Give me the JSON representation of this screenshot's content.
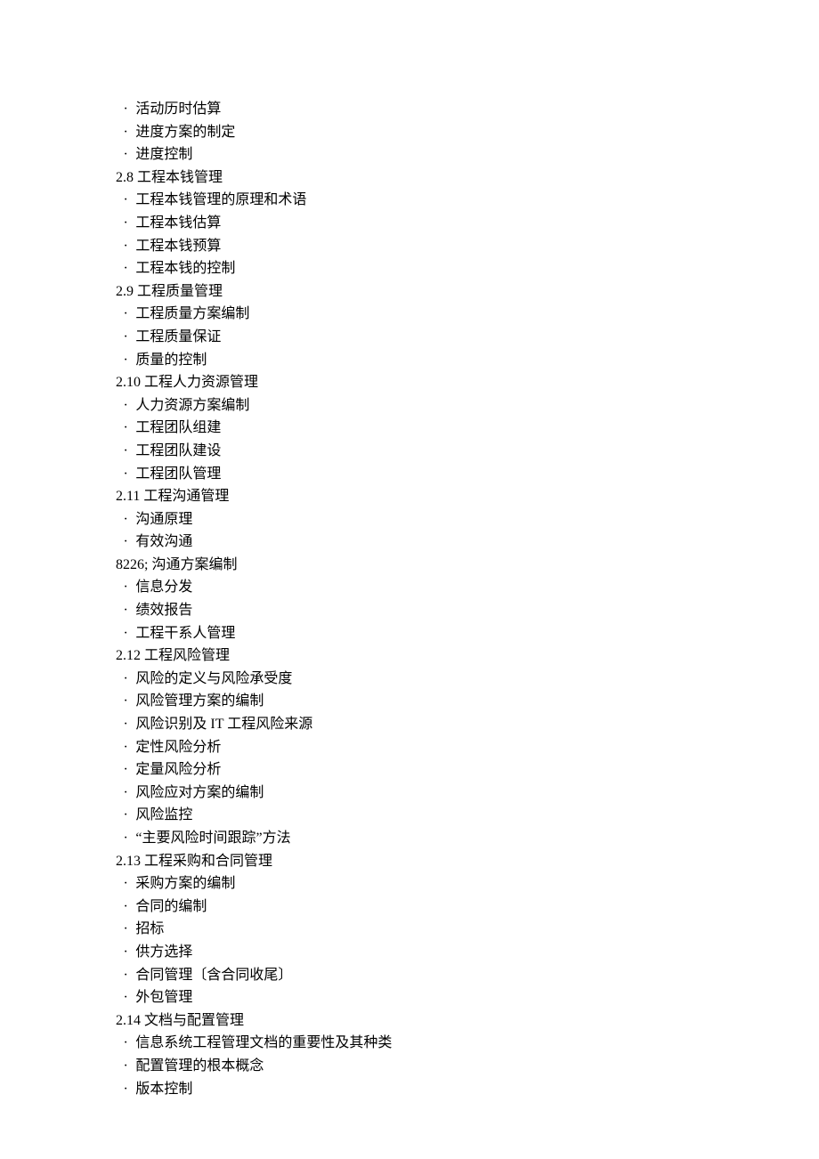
{
  "lines": [
    {
      "type": "bullet",
      "text": "活动历时估算"
    },
    {
      "type": "bullet",
      "text": "进度方案的制定"
    },
    {
      "type": "bullet",
      "text": "进度控制"
    },
    {
      "type": "heading",
      "text": "2.8 工程本钱管理"
    },
    {
      "type": "bullet",
      "text": "工程本钱管理的原理和术语"
    },
    {
      "type": "bullet",
      "text": "工程本钱估算"
    },
    {
      "type": "bullet",
      "text": "工程本钱预算"
    },
    {
      "type": "bullet",
      "text": "工程本钱的控制"
    },
    {
      "type": "heading",
      "text": "2.9 工程质量管理"
    },
    {
      "type": "bullet",
      "text": "工程质量方案编制"
    },
    {
      "type": "bullet",
      "text": "工程质量保证"
    },
    {
      "type": "bullet",
      "text": "质量的控制"
    },
    {
      "type": "heading",
      "text": "2.10 工程人力资源管理"
    },
    {
      "type": "bullet",
      "text": "人力资源方案编制"
    },
    {
      "type": "bullet",
      "text": "工程团队组建"
    },
    {
      "type": "bullet",
      "text": "工程团队建设"
    },
    {
      "type": "bullet",
      "text": "工程团队管理"
    },
    {
      "type": "heading",
      "text": "2.11 工程沟通管理"
    },
    {
      "type": "bullet",
      "text": "沟通原理"
    },
    {
      "type": "bullet",
      "text": "有效沟通"
    },
    {
      "type": "raw",
      "text": "8226; 沟通方案编制"
    },
    {
      "type": "bullet",
      "text": "信息分发"
    },
    {
      "type": "bullet",
      "text": "绩效报告"
    },
    {
      "type": "bullet",
      "text": "工程干系人管理"
    },
    {
      "type": "heading",
      "text": "2.12 工程风险管理"
    },
    {
      "type": "bullet",
      "text": "风险的定义与风险承受度"
    },
    {
      "type": "bullet",
      "text": "风险管理方案的编制"
    },
    {
      "type": "bullet",
      "text": "风险识别及 IT 工程风险来源"
    },
    {
      "type": "bullet",
      "text": "定性风险分析"
    },
    {
      "type": "bullet",
      "text": "定量风险分析"
    },
    {
      "type": "bullet",
      "text": "风险应对方案的编制"
    },
    {
      "type": "bullet",
      "text": "风险监控"
    },
    {
      "type": "bullet",
      "text": "“主要风险时间跟踪”方法"
    },
    {
      "type": "heading",
      "text": "2.13 工程采购和合同管理"
    },
    {
      "type": "bullet",
      "text": "采购方案的编制"
    },
    {
      "type": "bullet",
      "text": "合同的编制"
    },
    {
      "type": "bullet",
      "text": "招标"
    },
    {
      "type": "bullet",
      "text": "供方选择"
    },
    {
      "type": "bullet",
      "text": "合同管理〔含合同收尾〕"
    },
    {
      "type": "bullet",
      "text": "外包管理"
    },
    {
      "type": "heading",
      "text": "2.14 文档与配置管理"
    },
    {
      "type": "bullet",
      "text": "信息系统工程管理文档的重要性及其种类"
    },
    {
      "type": "bullet",
      "text": "配置管理的根本概念"
    },
    {
      "type": "bullet",
      "text": "版本控制"
    }
  ]
}
